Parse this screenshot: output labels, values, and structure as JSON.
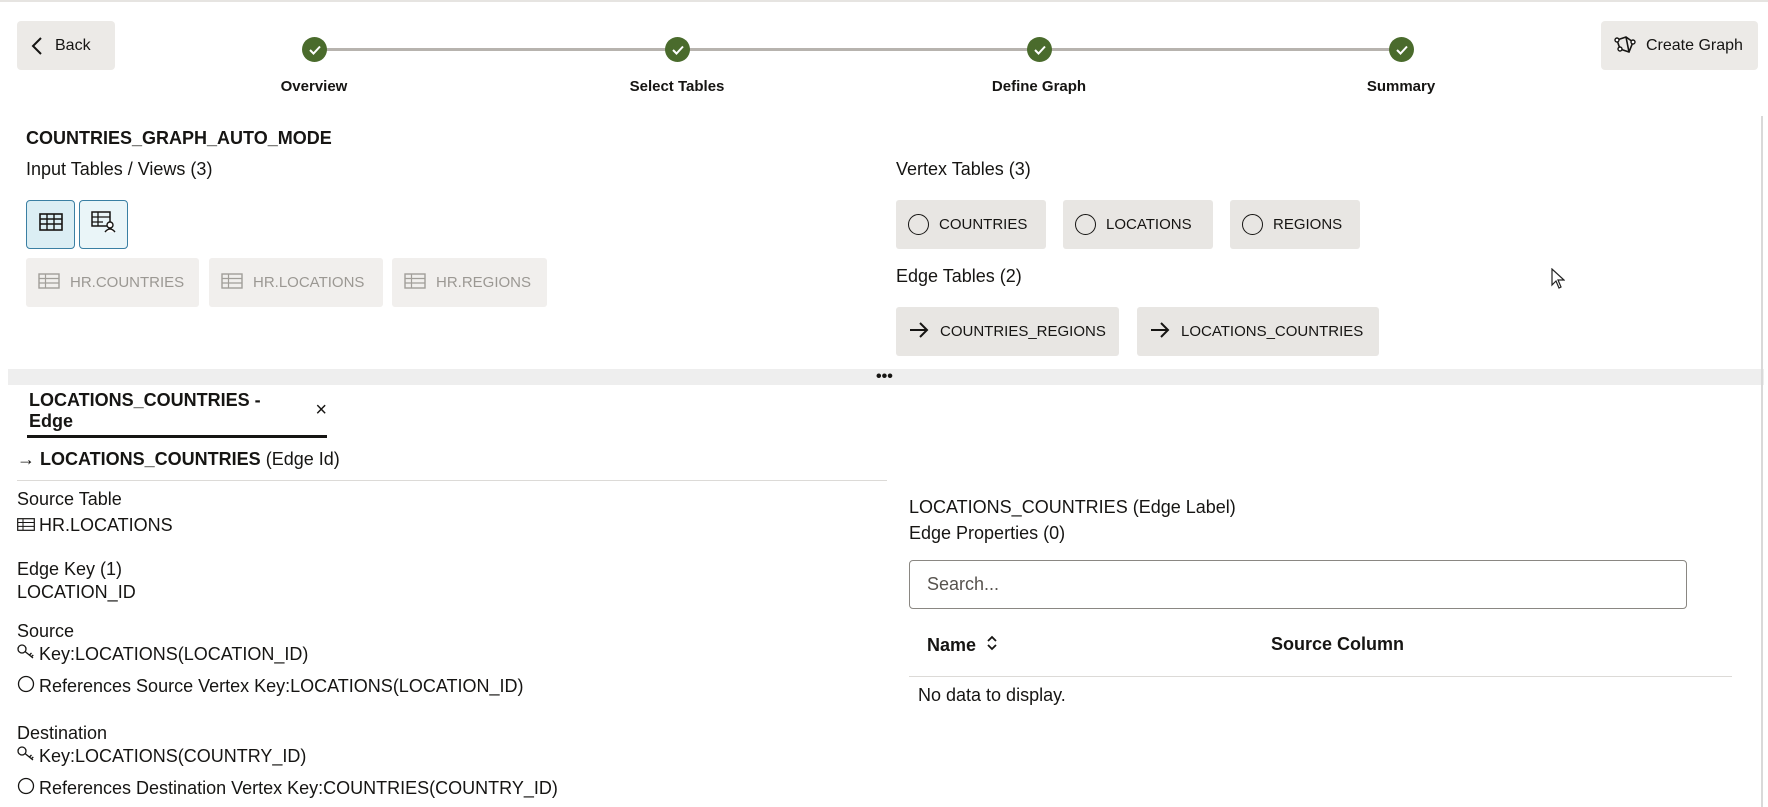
{
  "header": {
    "back_label": "Back",
    "create_label": "Create Graph"
  },
  "steps": [
    {
      "label": "Overview",
      "status": "complete"
    },
    {
      "label": "Select Tables",
      "status": "complete"
    },
    {
      "label": "Define Graph",
      "status": "complete"
    },
    {
      "label": "Summary",
      "status": "complete"
    }
  ],
  "graph_name": "COUNTRIES_GRAPH_AUTO_MODE",
  "input_tables": {
    "title": "Input Tables / Views (3)",
    "items": [
      "HR.COUNTRIES",
      "HR.LOCATIONS",
      "HR.REGIONS"
    ]
  },
  "vertex_tables": {
    "title": "Vertex Tables (3)",
    "items": [
      "COUNTRIES",
      "LOCATIONS",
      "REGIONS"
    ]
  },
  "edge_tables": {
    "title": "Edge Tables (2)",
    "items": [
      "COUNTRIES_REGIONS",
      "LOCATIONS_COUNTRIES"
    ]
  },
  "tab": {
    "label": "LOCATIONS_COUNTRIES - Edge"
  },
  "edge_detail": {
    "edge_name": "LOCATIONS_COUNTRIES",
    "edge_id_suffix": "(Edge Id)",
    "source_table_label": "Source Table",
    "source_table_value": "HR.LOCATIONS",
    "edge_key_label": "Edge Key (1)",
    "edge_key_value": "LOCATION_ID",
    "source_label": "Source",
    "source_key": "Key:LOCATIONS(LOCATION_ID)",
    "source_ref": "References Source Vertex Key:LOCATIONS(LOCATION_ID)",
    "destination_label": "Destination",
    "destination_key": "Key:LOCATIONS(COUNTRY_ID)",
    "destination_ref": "References Destination Vertex Key:COUNTRIES(COUNTRY_ID)"
  },
  "properties": {
    "edge_label": "LOCATIONS_COUNTRIES (Edge Label)",
    "title": "Edge Properties (0)",
    "search_placeholder": "Search...",
    "columns": [
      "Name",
      "Source Column"
    ],
    "empty_text": "No data to display."
  },
  "colors": {
    "step_complete": "#4a6b2c",
    "toggle_border": "#3a7fa3",
    "chip_bg": "#e8e6e3"
  }
}
